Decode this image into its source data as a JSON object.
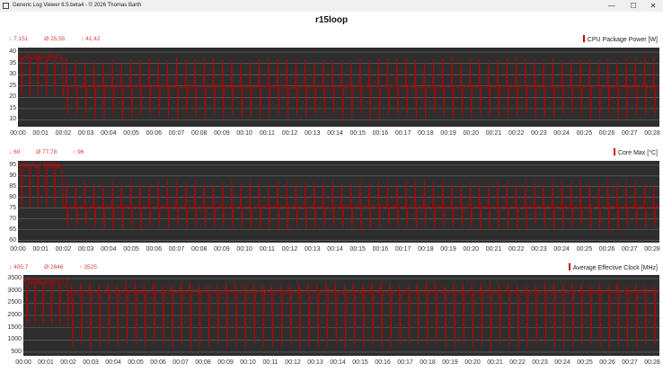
{
  "window": {
    "title": "Generic Log Viewer 6.5.beta4 - © 2026 Thomas Barth",
    "controls": [
      "—",
      "☐",
      "✕"
    ]
  },
  "document_title": "r15loop",
  "colors": {
    "series": "#c00000",
    "plot_bg": "#2e2e2e",
    "grid": "#6a6a6a",
    "stats": "#d04040"
  },
  "chart_data": [
    {
      "type": "line",
      "title": "CPU Package Power [W]",
      "stats": {
        "min": "7,151",
        "avg": "25,55",
        "max": "41,42"
      },
      "yticks": [
        40,
        35,
        30,
        25,
        20,
        15,
        10
      ],
      "ylim": [
        7,
        42
      ],
      "xticks": [
        "00:00",
        "00:01",
        "00:02",
        "00:03",
        "00:04",
        "00:05",
        "00:06",
        "00:07",
        "00:08",
        "00:09",
        "00:10",
        "00:11",
        "00:12",
        "00:13",
        "00:14",
        "00:15",
        "00:16",
        "00:17",
        "00:18",
        "00:19",
        "00:20",
        "00:21",
        "00:22",
        "00:23",
        "00:24",
        "00:25",
        "00:26",
        "00:27",
        "00:28"
      ],
      "baseline": 24.5,
      "initial_level": 38,
      "spike_high": 37,
      "dip_low": 10
    },
    {
      "type": "line",
      "title": "Core Max [°C]",
      "stats": {
        "min": "60",
        "avg": "77,78",
        "max": "96"
      },
      "yticks": [
        95,
        90,
        85,
        80,
        75,
        70,
        65,
        60
      ],
      "ylim": [
        59,
        97
      ],
      "xticks": [
        "00:00",
        "00:01",
        "00:02",
        "00:03",
        "00:04",
        "00:05",
        "00:06",
        "00:07",
        "00:08",
        "00:09",
        "00:10",
        "00:11",
        "00:12",
        "00:13",
        "00:14",
        "00:15",
        "00:16",
        "00:17",
        "00:18",
        "00:19",
        "00:20",
        "00:21",
        "00:22",
        "00:23",
        "00:24",
        "00:25",
        "00:26",
        "00:27",
        "00:28"
      ],
      "baseline": 75.5,
      "initial_level": 95,
      "spike_high": 87,
      "dip_low": 64
    },
    {
      "type": "line",
      "title": "Average Effective Clock [MHz]",
      "stats": {
        "min": "405,7",
        "avg": "2846",
        "max": "3525"
      },
      "yticks": [
        3500,
        3000,
        2500,
        2000,
        1500,
        1000,
        500
      ],
      "ylim": [
        350,
        3650
      ],
      "xticks": [
        "00:00",
        "00:01",
        "00:02",
        "00:03",
        "00:04",
        "00:05",
        "00:06",
        "00:07",
        "00:08",
        "00:09",
        "00:10",
        "00:11",
        "00:12",
        "00:13",
        "00:14",
        "00:15",
        "00:16",
        "00:17",
        "00:18",
        "00:19",
        "00:20",
        "00:21",
        "00:22",
        "00:23",
        "00:24",
        "00:25",
        "00:26",
        "00:27",
        "00:28"
      ],
      "baseline": 2950,
      "initial_level": 3400,
      "spike_high": 3300,
      "dip_low": 600
    }
  ]
}
